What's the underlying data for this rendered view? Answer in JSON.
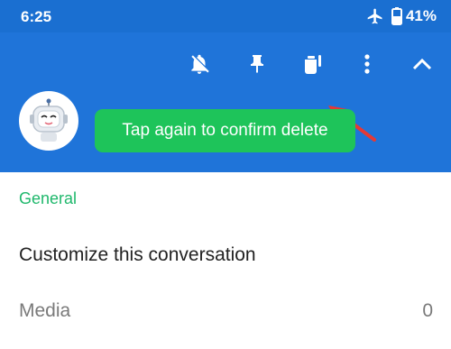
{
  "status_bar": {
    "time": "6:25",
    "battery": "41%",
    "icons": [
      "airplane-icon",
      "battery-icon"
    ]
  },
  "app_bar": {
    "actions": [
      "mute-notifications-icon",
      "pin-icon",
      "delete-icon",
      "more-vert-icon",
      "collapse-icon"
    ],
    "avatar": "bot-avatar"
  },
  "toast": {
    "message": "Tap again to confirm delete"
  },
  "settings": {
    "section_header": "General",
    "customize_label": "Customize this conversation",
    "media_label": "Media",
    "media_count": "0"
  },
  "colors": {
    "app_bar": "#1f74d9",
    "status_bar": "#1a6fd1",
    "toast": "#1ec45a",
    "section_header": "#1fb86c",
    "arrow": "#e53935"
  }
}
